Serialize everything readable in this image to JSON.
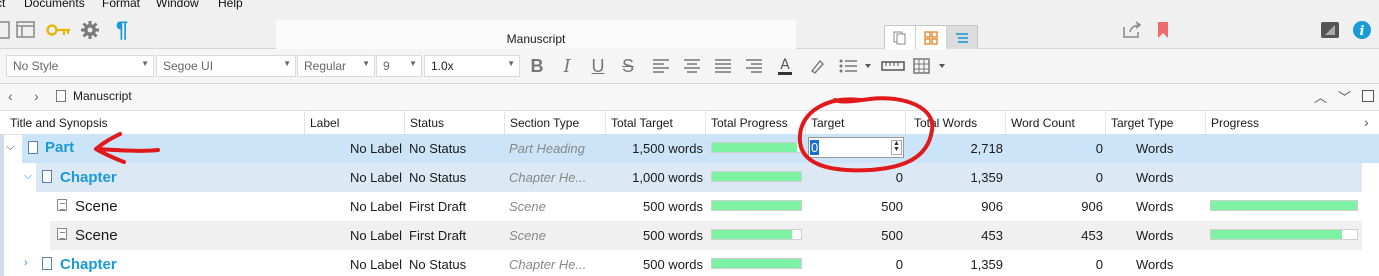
{
  "menu": [
    "ct",
    "Documents",
    "Format",
    "Window",
    "Help"
  ],
  "window": {
    "title": "Manuscript"
  },
  "format": {
    "style": "No Style",
    "font": "Segoe UI",
    "weight": "Regular",
    "size": "9",
    "spacing": "1.0x"
  },
  "nav": {
    "breadcrumb": "Manuscript"
  },
  "columns": [
    "Title and Synopsis",
    "Label",
    "Status",
    "Section Type",
    "Total Target",
    "Total Progress",
    "Target",
    "Total Words",
    "Word Count",
    "Target Type",
    "Progress"
  ],
  "rows": [
    {
      "title": "Part",
      "label": "No Label",
      "status": "No Status",
      "section_type": "Part Heading",
      "total_target": "1,500 words",
      "total_progress": 0.95,
      "target": "0",
      "total_words": "2,718",
      "word_count": "0",
      "target_type": "Words",
      "progress": null
    },
    {
      "title": "Chapter",
      "label": "No Label",
      "status": "No Status",
      "section_type": "Chapter He...",
      "total_target": "1,000 words",
      "total_progress": 1.0,
      "target": "0",
      "total_words": "1,359",
      "word_count": "0",
      "target_type": "Words",
      "progress": null
    },
    {
      "title": "Scene",
      "label": "No Label",
      "status": "First Draft",
      "section_type": "Scene",
      "total_target": "500 words",
      "total_progress": 1.0,
      "target": "500",
      "total_words": "906",
      "word_count": "906",
      "target_type": "Words",
      "progress": 1.0
    },
    {
      "title": "Scene",
      "label": "No Label",
      "status": "First Draft",
      "section_type": "Scene",
      "total_target": "500 words",
      "total_progress": 0.9,
      "target": "500",
      "total_words": "453",
      "word_count": "453",
      "target_type": "Words",
      "progress": 0.9
    },
    {
      "title": "Chapter",
      "label": "No Label",
      "status": "No Status",
      "section_type": "Chapter He...",
      "total_target": "500 words",
      "total_progress": 1.0,
      "target": "0",
      "total_words": "1,359",
      "word_count": "0",
      "target_type": "Words",
      "progress": null
    }
  ],
  "edit": {
    "target_value": "0"
  },
  "colors": {
    "selected_row": "#cce4f7",
    "group_row": "#dce9f4",
    "progress_fill": "#7ef2a3",
    "annotation": "#e0191b",
    "accent": "#1a9ad6"
  }
}
